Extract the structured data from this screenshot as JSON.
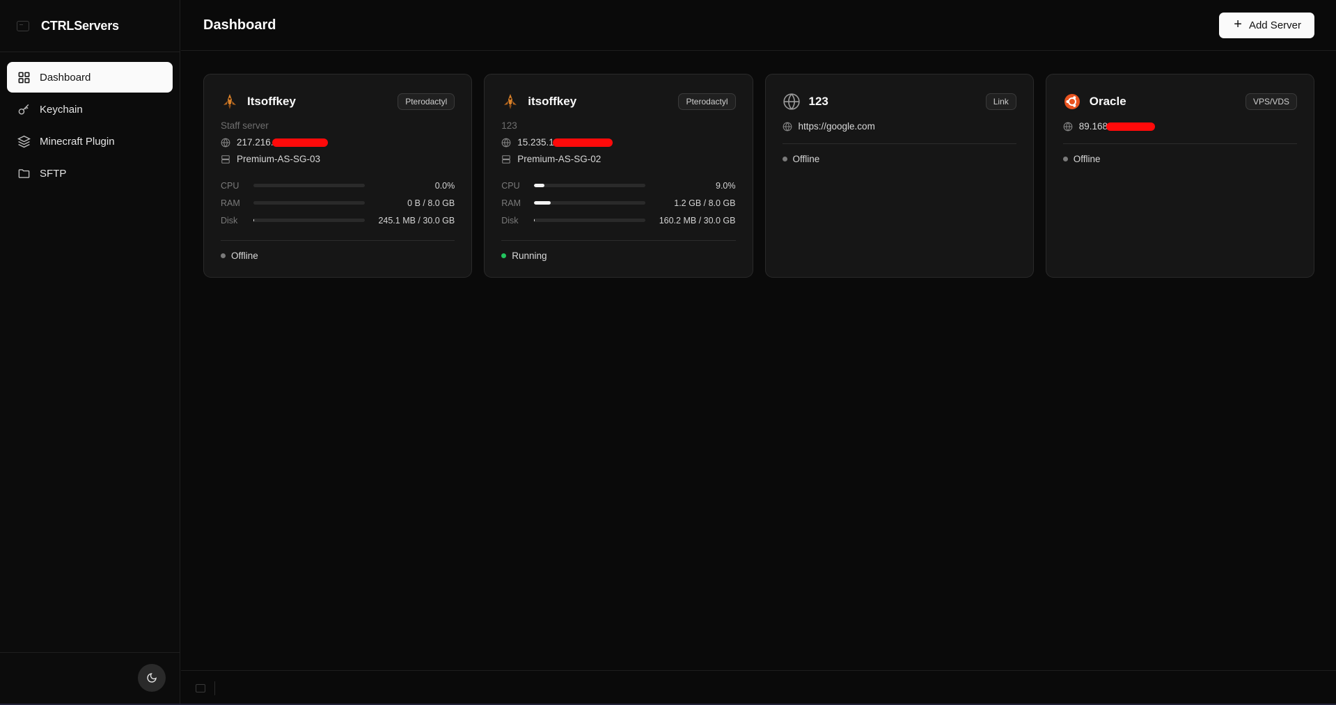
{
  "app": {
    "name": "CTRLServers"
  },
  "sidebar": {
    "items": [
      {
        "label": "Dashboard",
        "icon": "grid-icon",
        "active": true
      },
      {
        "label": "Keychain",
        "icon": "key-icon",
        "active": false
      },
      {
        "label": "Minecraft Plugin",
        "icon": "layers-icon",
        "active": false
      },
      {
        "label": "SFTP",
        "icon": "folder-icon",
        "active": false
      }
    ],
    "theme_toggle_icon": "moon-icon"
  },
  "header": {
    "title": "Dashboard",
    "add_button_label": "Add Server"
  },
  "servers": [
    {
      "name": "Itsoffkey",
      "icon": "pterodactyl-icon",
      "badge": "Pterodactyl",
      "description": "Staff server",
      "ip": "217.216.",
      "node": "Premium-AS-SG-03",
      "metrics": {
        "cpu": {
          "label": "CPU",
          "value": "0.0%",
          "fraction": 0.0
        },
        "ram": {
          "label": "RAM",
          "value": "0 B / 8.0 GB",
          "fraction": 0.0
        },
        "disk": {
          "label": "Disk",
          "value": "245.1 MB / 30.0 GB",
          "fraction": 0.008
        }
      },
      "status": "Offline",
      "status_color": "#7a7a7a"
    },
    {
      "name": "itsoffkey",
      "icon": "pterodactyl-icon",
      "badge": "Pterodactyl",
      "description": "123",
      "ip": "15.235.1",
      "node": "Premium-AS-SG-02",
      "metrics": {
        "cpu": {
          "label": "CPU",
          "value": "9.0%",
          "fraction": 0.09
        },
        "ram": {
          "label": "RAM",
          "value": "1.2 GB / 8.0 GB",
          "fraction": 0.15
        },
        "disk": {
          "label": "Disk",
          "value": "160.2 MB / 30.0 GB",
          "fraction": 0.005
        }
      },
      "status": "Running",
      "status_color": "#22c55e"
    },
    {
      "name": "123",
      "icon": "globe-icon",
      "badge": "Link",
      "url": "https://google.com",
      "status": "Offline",
      "status_color": "#7a7a7a"
    },
    {
      "name": "Oracle",
      "icon": "ubuntu-icon",
      "badge": "VPS/VDS",
      "ip": "89.168",
      "status": "Offline",
      "status_color": "#7a7a7a"
    }
  ],
  "colors": {
    "background": "#0a0a0a",
    "card": "#161616",
    "accent": "#fafafa",
    "running": "#22c55e",
    "ubuntu": "#e95420",
    "redaction": "#ff0a0a"
  }
}
